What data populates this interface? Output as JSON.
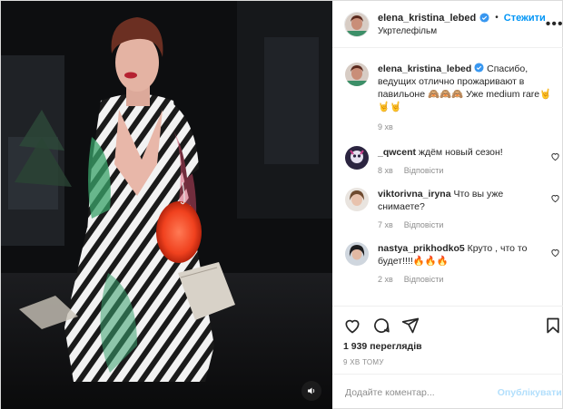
{
  "header": {
    "username": "elena_kristina_lebed",
    "separator": "•",
    "follow_label": "Стежити",
    "location": "Укртелефільм",
    "more": "•••"
  },
  "caption": {
    "username": "elena_kristina_lebed",
    "text": "Спасибо, ведущих отлично прожаривают в павильоне 🙈🙈🙈 Уже medium rare🤘🤘🤘",
    "time": "9 хв"
  },
  "comments": [
    {
      "username": "_qwcent",
      "text": "ждём новый сезон!",
      "time": "8 хв",
      "reply": "Відповісти"
    },
    {
      "username": "viktorivna_iryna",
      "text": "Что вы уже снимаете?",
      "time": "7 хв",
      "reply": "Відповісти"
    },
    {
      "username": "nastya_prikhodko5",
      "text": "Круто , что то будет!!!!🔥🔥🔥",
      "time": "2 хв",
      "reply": "Відповісти"
    }
  ],
  "stats": {
    "views": "1 939 переглядів",
    "ago": "9 ХВ ТОМУ"
  },
  "add_comment": {
    "placeholder": "Додайте коментар...",
    "post_label": "Опублікувати"
  },
  "colors": {
    "accent": "#0095f6",
    "post_disabled": "#b2dffc",
    "muted": "#8e8e8e",
    "text": "#262626"
  },
  "icons": {
    "verified": "verified-badge-icon",
    "like": "heart-icon",
    "comment": "speech-bubble-icon",
    "share": "paper-plane-icon",
    "save": "bookmark-icon",
    "sound": "speaker-icon",
    "more": "more-options-icon"
  }
}
